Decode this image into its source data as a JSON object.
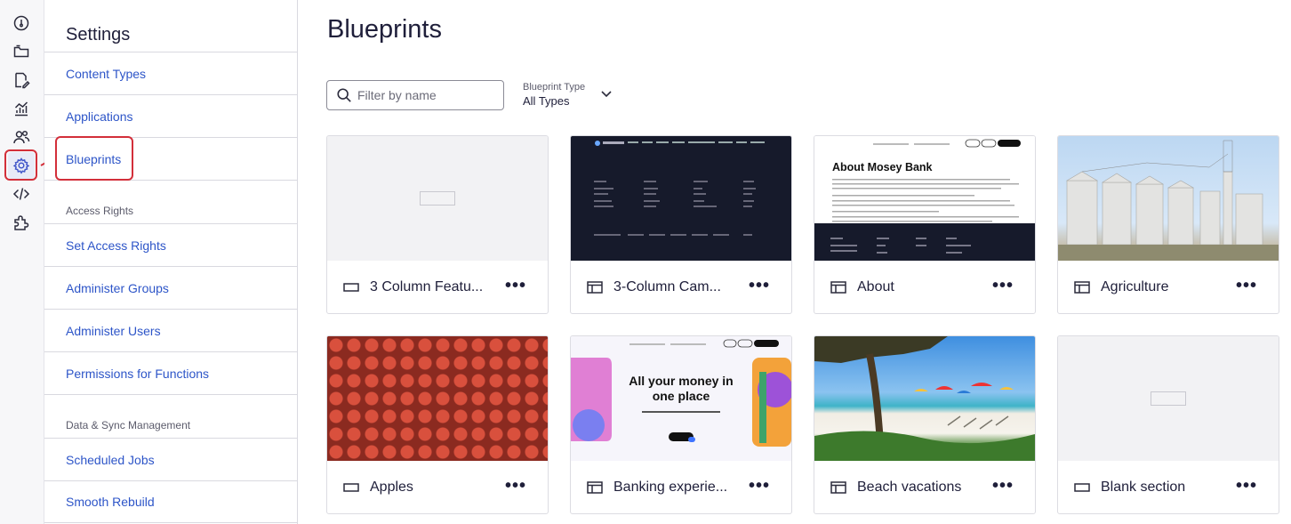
{
  "rail": {
    "items": [
      {
        "name": "dashboard-icon"
      },
      {
        "name": "folder-icon"
      },
      {
        "name": "edit-document-icon"
      },
      {
        "name": "analytics-icon"
      },
      {
        "name": "users-icon"
      },
      {
        "name": "gear-icon",
        "active": true
      },
      {
        "name": "code-icon"
      },
      {
        "name": "puzzle-icon"
      }
    ]
  },
  "settings": {
    "title": "Settings",
    "items": [
      {
        "label": "Content Types"
      },
      {
        "label": "Applications"
      },
      {
        "label": "Blueprints",
        "selected": true
      }
    ],
    "access_section": "Access Rights",
    "access_items": [
      {
        "label": "Set Access Rights"
      },
      {
        "label": "Administer Groups"
      },
      {
        "label": "Administer Users"
      },
      {
        "label": "Permissions for Functions"
      }
    ],
    "sync_section": "Data & Sync Management",
    "sync_items": [
      {
        "label": "Scheduled Jobs"
      },
      {
        "label": "Smooth Rebuild"
      }
    ]
  },
  "main": {
    "title": "Blueprints",
    "search_placeholder": "Filter by name",
    "type_label": "Blueprint Type",
    "type_value": "All Types",
    "more_label": "•••",
    "cards": [
      {
        "name": "3 Column Featu...",
        "icon": "section-icon",
        "thumb": "placeholder"
      },
      {
        "name": "3-Column Cam...",
        "icon": "page-icon",
        "thumb": "dark-footer"
      },
      {
        "name": "About",
        "icon": "page-icon",
        "thumb": "about-page",
        "thumb_heading": "About Mosey Bank"
      },
      {
        "name": "Agriculture",
        "icon": "page-icon",
        "thumb": "silos"
      },
      {
        "name": "Apples",
        "icon": "section-icon",
        "thumb": "apples"
      },
      {
        "name": "Banking experie...",
        "icon": "page-icon",
        "thumb": "banking",
        "thumb_heading": "All your money in one place"
      },
      {
        "name": "Beach vacations",
        "icon": "page-icon",
        "thumb": "beach"
      },
      {
        "name": "Blank section",
        "icon": "section-icon",
        "thumb": "placeholder"
      }
    ]
  },
  "colors": {
    "link": "#2d55c8",
    "highlight": "#d32f3a",
    "active_rail": "#4257c9"
  }
}
